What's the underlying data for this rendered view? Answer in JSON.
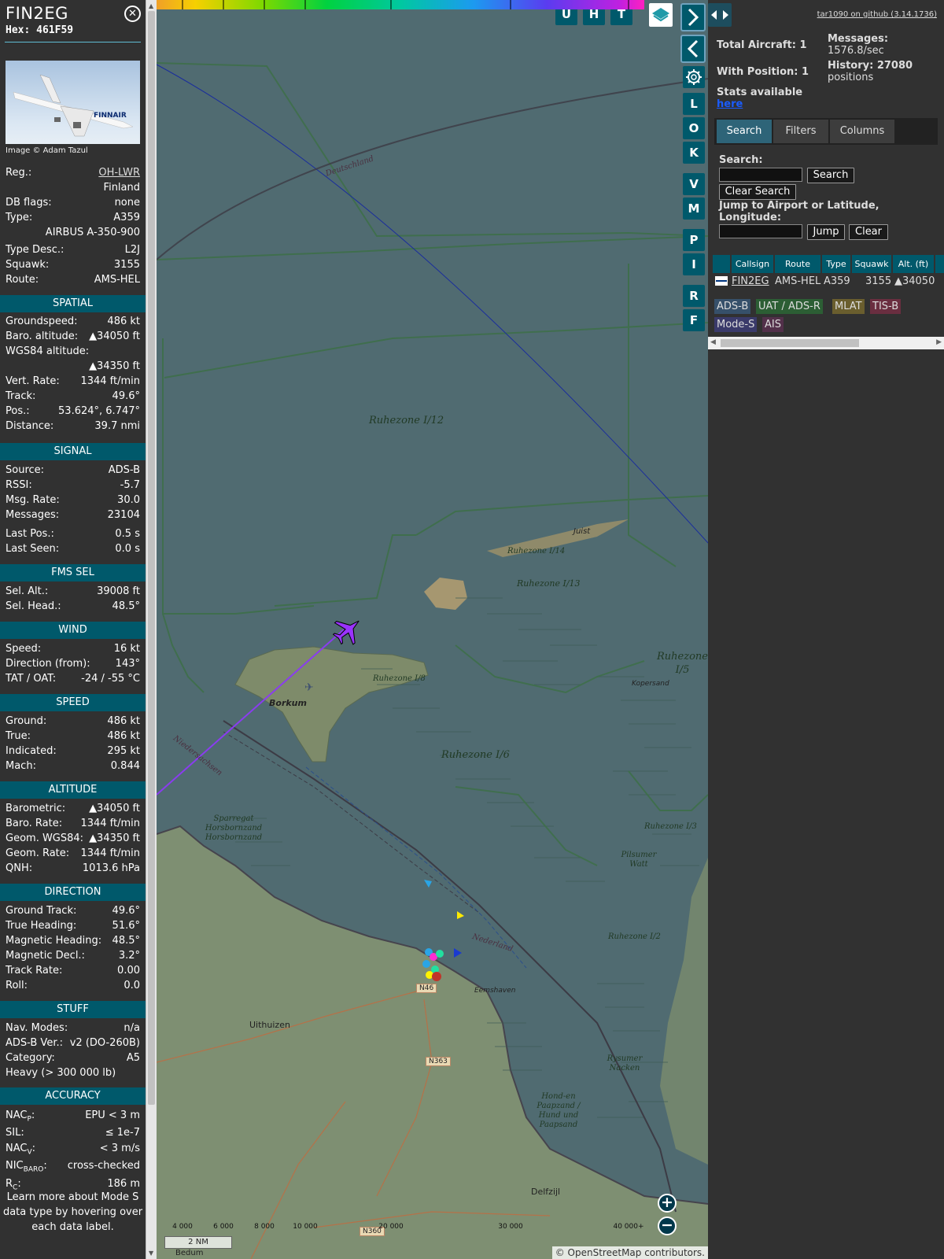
{
  "header": {
    "callsign": "FIN2EG",
    "hex": "Hex: 461F59"
  },
  "photo": {
    "credit": "Image © Adam Tazul",
    "livery": "FINNAIR"
  },
  "aircraft": [
    {
      "label": "Reg.:",
      "value": "OH-LWR"
    },
    {
      "label": "",
      "value": "Finland"
    },
    {
      "label": "DB flags:",
      "value": "none"
    },
    {
      "label": "Type:",
      "value": "A359"
    },
    {
      "label": "",
      "value": "AIRBUS A-350-900"
    },
    {
      "label": "Type Desc.:",
      "value": "L2J"
    },
    {
      "label": "Squawk:",
      "value": "3155"
    },
    {
      "label": "Route:",
      "value": "AMS-HEL"
    }
  ],
  "sections": {
    "spatial": "SPATIAL",
    "signal": "SIGNAL",
    "fms": "FMS SEL",
    "wind": "WIND",
    "speed": "SPEED",
    "altitude": "ALTITUDE",
    "direction": "DIRECTION",
    "stuff": "STUFF",
    "accuracy": "ACCURACY"
  },
  "spatial": [
    {
      "label": "Groundspeed:",
      "value": "486 kt"
    },
    {
      "label": "Baro. altitude:",
      "value": "▲34050 ft"
    },
    {
      "label": "WGS84 altitude:",
      "value": ""
    },
    {
      "label": "",
      "value": "▲34350 ft"
    },
    {
      "label": "Vert. Rate:",
      "value": "1344 ft/min"
    },
    {
      "label": "Track:",
      "value": "49.6°"
    },
    {
      "label": "Pos.:",
      "value": "53.624°, 6.747°"
    },
    {
      "label": "Distance:",
      "value": "39.7 nmi"
    }
  ],
  "signal": [
    {
      "label": "Source:",
      "value": "ADS-B"
    },
    {
      "label": "RSSI:",
      "value": "-5.7"
    },
    {
      "label": "Msg. Rate:",
      "value": "30.0"
    },
    {
      "label": "Messages:",
      "value": "23104"
    },
    {
      "label": "Last Pos.:",
      "value": "0.5 s"
    },
    {
      "label": "Last Seen:",
      "value": "0.0 s"
    }
  ],
  "fms": [
    {
      "label": "Sel. Alt.:",
      "value": "39008 ft"
    },
    {
      "label": "Sel. Head.:",
      "value": "48.5°"
    }
  ],
  "wind": [
    {
      "label": "Speed:",
      "value": "16 kt"
    },
    {
      "label": "Direction (from):",
      "value": "143°"
    },
    {
      "label": "TAT / OAT:",
      "value": "-24 / -55 °C"
    }
  ],
  "speed": [
    {
      "label": "Ground:",
      "value": "486 kt"
    },
    {
      "label": "True:",
      "value": "486 kt"
    },
    {
      "label": "Indicated:",
      "value": "295 kt"
    },
    {
      "label": "Mach:",
      "value": "0.844"
    }
  ],
  "altitude": [
    {
      "label": "Barometric:",
      "value": "▲34050 ft"
    },
    {
      "label": "Baro. Rate:",
      "value": "1344 ft/min"
    },
    {
      "label": "Geom. WGS84:",
      "value": "▲34350 ft"
    },
    {
      "label": "Geom. Rate:",
      "value": "1344 ft/min"
    },
    {
      "label": "QNH:",
      "value": "1013.6 hPa"
    }
  ],
  "direction": [
    {
      "label": "Ground Track:",
      "value": "49.6°"
    },
    {
      "label": "True Heading:",
      "value": "51.6°"
    },
    {
      "label": "Magnetic Heading:",
      "value": "48.5°"
    },
    {
      "label": "Magnetic Decl.:",
      "value": "3.2°"
    },
    {
      "label": "Track Rate:",
      "value": "0.00"
    },
    {
      "label": "Roll:",
      "value": "0.0"
    }
  ],
  "stuff": [
    {
      "label": "Nav. Modes:",
      "value": "n/a"
    },
    {
      "label": "ADS-B Ver.:",
      "value": "v2 (DO-260B)"
    },
    {
      "label": "Category:",
      "value": "A5"
    },
    {
      "label": "Heavy (> 300 000 lb)",
      "value": ""
    }
  ],
  "accuracy": [
    {
      "label": "NAC",
      "sub": "P",
      "value": "EPU < 3 m"
    },
    {
      "label": "SIL:",
      "sub": "",
      "value": "≤ 1e-7"
    },
    {
      "label": "NAC",
      "sub": "V",
      "value": "< 3 m/s"
    },
    {
      "label": "NIC",
      "sub": "BARO",
      "value": "cross-checked"
    },
    {
      "label": "R",
      "sub": "C",
      "value": "186 m"
    }
  ],
  "learn_more": "Learn more about Mode S data type by hovering over each data label.",
  "map": {
    "labels": [
      "Ruhezone I/12",
      "Ruhezone I/6",
      "Ruhezone I/5",
      "Ruhezone I/14",
      "Ruhezone I/13",
      "Ruhezone I/8",
      "Ruhezone I/3",
      "Ruhezone I/2",
      "Deutschland",
      "Nederland",
      "Niedersachsen",
      "Borkum",
      "Juist",
      "Kopersand",
      "Sparregat Horsbornzand Horsbornzand",
      "Pilsumer Watt",
      "Rysumer Nacken",
      "Hond-en Paapzand / Hund und Paapsand",
      "Uithuizen",
      "Eemshaven",
      "Delfzijl",
      "Bedum",
      "N46",
      "N363",
      "N360"
    ],
    "scale": "2 NM",
    "attribution": "© OpenStreetMap contributors.",
    "altitude_ticks": [
      "4 000",
      "6 000",
      "8 000",
      "10 000",
      "20 000",
      "30 000",
      "40 000+"
    ],
    "buttons_top": [
      "U",
      "H",
      "T"
    ],
    "buttons_side": [
      "L",
      "O",
      "K",
      "V",
      "M",
      "P",
      "I",
      "R",
      "F"
    ],
    "zoom_in": "+",
    "zoom_out": "−"
  },
  "stats": {
    "github": "tar1090 on github (3.14.1736)",
    "total_aircraft": "Total Aircraft: 1",
    "messages_label": "Messages:",
    "messages_value": "1576.8/sec",
    "with_position": "With Position: 1",
    "history_label": "History: 27080",
    "history_value": "positions",
    "stats_text": "Stats available",
    "stats_link": "here"
  },
  "tabs": [
    "Search",
    "Filters",
    "Columns"
  ],
  "search": {
    "label": "Search:",
    "search_btn": "Search",
    "clear_btn": "Clear Search",
    "jump_label": "Jump to Airport or Latitude, Longitude:",
    "jump_btn": "Jump",
    "clear": "Clear"
  },
  "table": {
    "headers": [
      "Callsign",
      "Route",
      "Type",
      "Squawk",
      "Alt. (ft)"
    ],
    "row": {
      "callsign": "FIN2EG",
      "route": "AMS-HEL",
      "type": "A359",
      "squawk": "3155",
      "alt": "▲34050"
    }
  },
  "legend": [
    "ADS-B",
    "UAT / ADS-R",
    "MLAT",
    "TIS-B",
    "Mode-S",
    "AIS"
  ],
  "colors": {
    "accent": "#00596b",
    "aircraft": "#9a33ff",
    "track": "#8a3cf0"
  }
}
